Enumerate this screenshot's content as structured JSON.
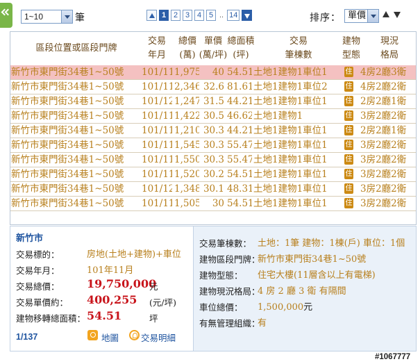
{
  "toolbar": {
    "page_size_selected": "1~10",
    "page_size_unit": "筆",
    "pages": [
      "1",
      "2",
      "3",
      "4",
      "5"
    ],
    "current_page": "1",
    "ellipsis": "..",
    "last_page": "14",
    "sort_label": "排序：",
    "sort_selected": "單價"
  },
  "grid": {
    "columns": {
      "address": "區段位置或區段門牌",
      "date": [
        "交易",
        "年月"
      ],
      "total": [
        "總價",
        "(萬)"
      ],
      "unit": [
        "單價",
        "(萬/坪)"
      ],
      "area": [
        "總面積",
        "(坪)"
      ],
      "items": [
        "交易",
        "筆棟數"
      ],
      "btype": [
        "建物",
        "型態"
      ],
      "layout": [
        "現況",
        "格局"
      ]
    },
    "rows": [
      {
        "address": "新竹市東門街34巷1~50號",
        "date": "101/11",
        "total": "1,975",
        "unit": "40",
        "area": "54.51",
        "items": "土地1建物1車位1",
        "btype": "住",
        "layout": "4房2廳3衛",
        "selected": true
      },
      {
        "address": "新竹市東門街34巷1~50號",
        "date": "101/11",
        "total": "2,346",
        "unit": "32.6",
        "area": "81.61",
        "items": "土地1建物1車位2",
        "btype": "住",
        "layout": "4房2廳2衛"
      },
      {
        "address": "新竹市東門街34巷1~50號",
        "date": "101/12",
        "total": "1,247",
        "unit": "31.5",
        "area": "44.21",
        "items": "土地1建物1車位1",
        "btype": "住",
        "layout": "2房2廳1衛"
      },
      {
        "address": "新竹市東門街34巷1~50號",
        "date": "101/11",
        "total": "1,422",
        "unit": "30.5",
        "area": "46.62",
        "items": "土地1建物1",
        "btype": "住",
        "layout": "3房2廳2衛"
      },
      {
        "address": "新竹市東門街34巷1~50號",
        "date": "101/11",
        "total": "1,210",
        "unit": "30.3",
        "area": "44.21",
        "items": "土地1建物1車位1",
        "btype": "住",
        "layout": "2房2廳1衛"
      },
      {
        "address": "新竹市東門街34巷1~50號",
        "date": "101/11",
        "total": "1,545",
        "unit": "30.3",
        "area": "55.47",
        "items": "土地1建物1車位1",
        "btype": "住",
        "layout": "3房2廳2衛"
      },
      {
        "address": "新竹市東門街34巷1~50號",
        "date": "101/11",
        "total": "1,550",
        "unit": "30.3",
        "area": "55.47",
        "items": "土地1建物1車位1",
        "btype": "住",
        "layout": "3房2廳2衛"
      },
      {
        "address": "新竹市東門街34巷1~50號",
        "date": "101/11",
        "total": "1,520",
        "unit": "30.2",
        "area": "54.51",
        "items": "土地1建物1車位1",
        "btype": "住",
        "layout": "3房2廳2衛"
      },
      {
        "address": "新竹市東門街34巷1~50號",
        "date": "101/12",
        "total": "1,348",
        "unit": "30.1",
        "area": "48.31",
        "items": "土地1建物1車位1",
        "btype": "住",
        "layout": "3房2廳2衛"
      },
      {
        "address": "新竹市東門街34巷1~50號",
        "date": "101/11",
        "total": "1,505",
        "unit": "30",
        "area": "54.51",
        "items": "土地1建物1車位1",
        "btype": "住",
        "layout": "3房2廳2衛"
      }
    ]
  },
  "detail": {
    "city": "新竹市",
    "left": {
      "target_label": "交易標的：",
      "target_value": "房地(土地+建物)+車位",
      "date_label": "交易年月：",
      "date_value": "101年11月",
      "total_label": "交易總價：",
      "total_value": "19,750,000",
      "total_unit": "元",
      "unit_label": "交易單價約：",
      "unit_value": "400,255",
      "unit_unit": "(元/坪)",
      "area_label": "建物移轉總面積：",
      "area_value": "54.51",
      "area_unit": "坪"
    },
    "right": {
      "items_label": "交易筆棟數：",
      "items_value": "土地：1筆 建物：1棟(戶) 車位：1個",
      "address_label": "建物區段門牌：",
      "address_value": "新竹市東門街34巷1~50號",
      "btype_label": "建物型態：",
      "btype_value": "住宅大樓(11層含以上有電梯)",
      "layout_label": "建物現況格局：",
      "layout_value": "4 房 2 廳 3 衛 有隔間",
      "parking_label": "車位總價：",
      "parking_value": "1,500,000",
      "parking_unit": "元",
      "mgmt_label": "有無管理組織：",
      "mgmt_value": "有"
    },
    "record_index": "1/137",
    "map_label": "地圖",
    "detail_label": "交易明細"
  },
  "watermark": "#1067777",
  "icons": {
    "collapse": "double-chevron-left-icon",
    "map": "map-pin-icon",
    "detail": "detail-icon",
    "building_type": "residential-badge-icon"
  },
  "colors": {
    "accent_green": "#7ab648",
    "pager_blue": "#2c5ea8",
    "row_text": "#b8801e",
    "selected_row": "#f4c1c1",
    "price_red": "#c8141b"
  }
}
